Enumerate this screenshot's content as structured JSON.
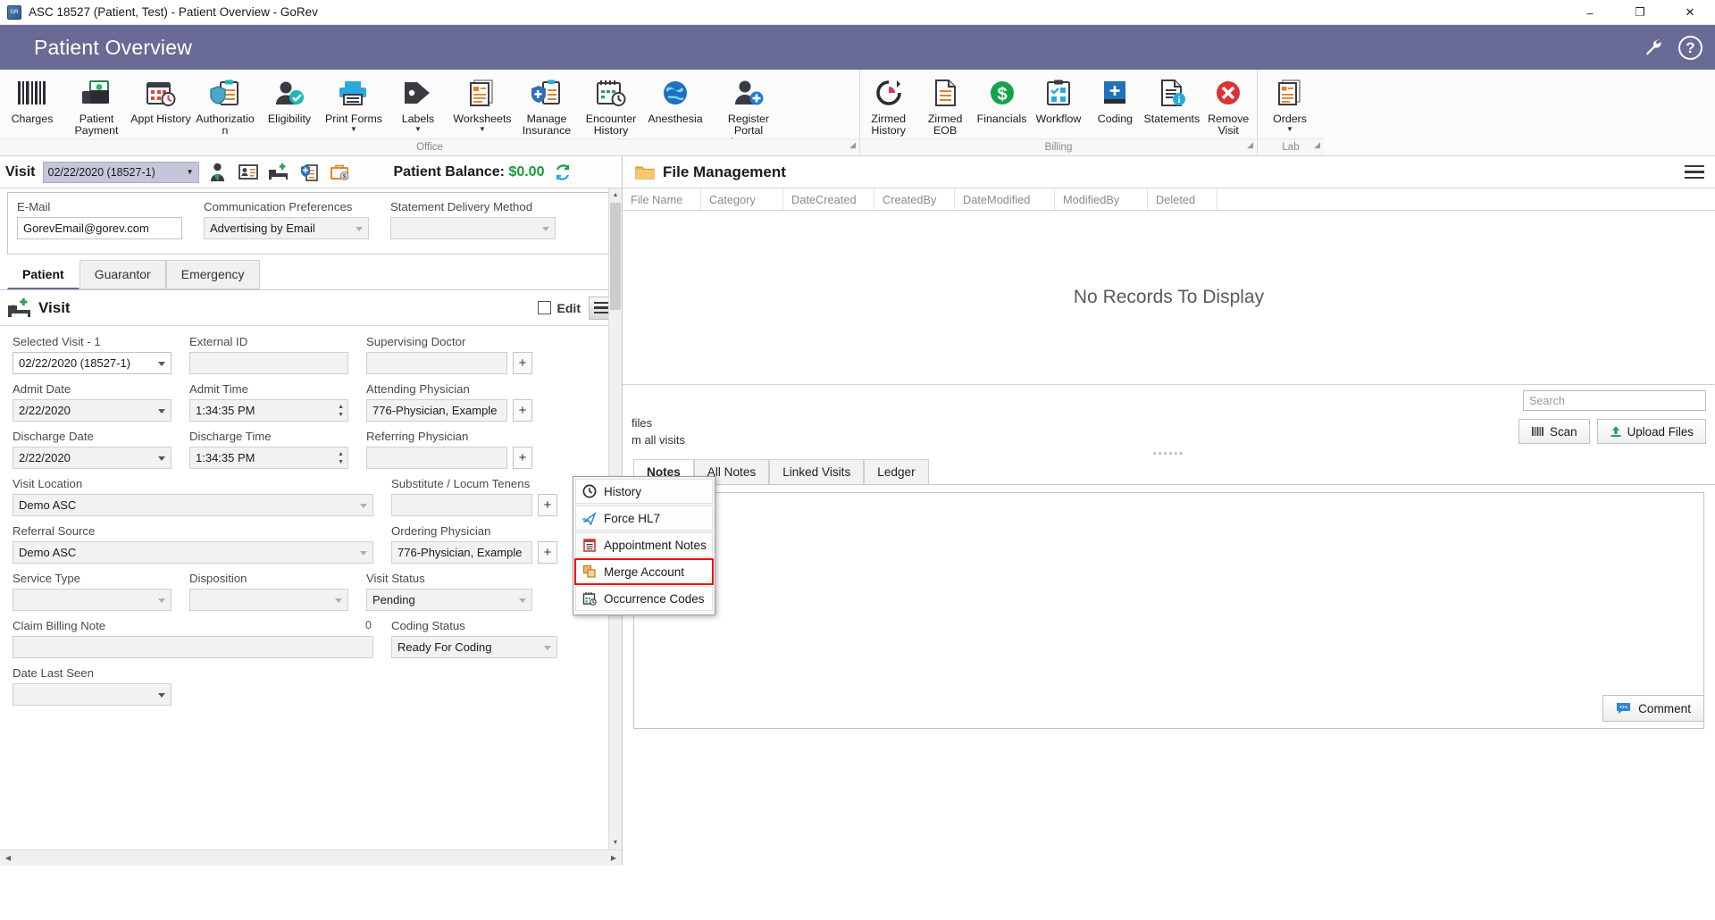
{
  "window": {
    "title": "ASC 18527 (Patient, Test) - Patient Overview - GoRev",
    "minimize": "–",
    "maximize": "❐",
    "close": "✕"
  },
  "header": {
    "title": "Patient Overview",
    "help_label": "?"
  },
  "ribbon": {
    "groups": [
      {
        "name": "Office",
        "label": "Office",
        "items": [
          {
            "label": "Charges",
            "icon": "barcode-icon",
            "caret": false
          },
          {
            "label": "Patient Payment",
            "icon": "money-icon",
            "caret": false
          },
          {
            "label": "Appt History",
            "icon": "calendar-clock-icon",
            "caret": false
          },
          {
            "label": "Authorization",
            "icon": "shield-clipboard-icon",
            "caret": false
          },
          {
            "label": "Eligibility",
            "icon": "person-check-icon",
            "caret": false
          },
          {
            "label": "Print Forms",
            "icon": "printer-icon",
            "caret": false
          },
          {
            "label": "Labels",
            "icon": "tag-icon",
            "caret": true
          },
          {
            "label": "Worksheets",
            "icon": "worksheet-icon",
            "caret": true
          },
          {
            "label": "Manage Insurance",
            "icon": "insurance-icon",
            "caret": false
          },
          {
            "label": "Encounter History",
            "icon": "calendar-history-icon",
            "caret": false
          },
          {
            "label": "Anesthesia",
            "icon": "anesthesia-icon",
            "caret": false
          },
          {
            "label": "Register Portal Account",
            "icon": "person-add-icon",
            "caret": false
          }
        ]
      },
      {
        "name": "Billing",
        "label": "Billing",
        "items": [
          {
            "label": "Zirmed History",
            "icon": "refresh-clock-icon",
            "caret": false
          },
          {
            "label": "Zirmed EOB",
            "icon": "document-list-icon",
            "caret": false
          },
          {
            "label": "Financials",
            "icon": "dollar-circle-icon",
            "caret": false
          },
          {
            "label": "Workflow",
            "icon": "clipboard-check-icon",
            "caret": false
          },
          {
            "label": "Coding",
            "icon": "book-plus-icon",
            "caret": false
          },
          {
            "label": "Statements",
            "icon": "document-info-icon",
            "caret": false
          },
          {
            "label": "Remove Visit",
            "icon": "red-x-icon",
            "caret": true
          }
        ]
      },
      {
        "name": "Lab",
        "label": "Lab",
        "items": [
          {
            "label": "Orders",
            "icon": "orders-icon",
            "caret": true
          }
        ]
      }
    ]
  },
  "visit_bar": {
    "label": "Visit",
    "selected_visit": "02/22/2020 (18527-1)",
    "icons": [
      "patient-icon",
      "id-card-icon",
      "bed-icon",
      "insurance-clipboard-icon",
      "briefcase-dollar-icon"
    ],
    "balance_label": "Patient Balance:",
    "balance_amount": "$0.00",
    "refresh_icon": "refresh-icon"
  },
  "contact": {
    "email_label": "E-Mail",
    "email_value": "GorevEmail@gorev.com",
    "comm_label": "Communication Preferences",
    "comm_value": "Advertising by Email",
    "stmt_label": "Statement Delivery Method",
    "stmt_value": ""
  },
  "tabs": [
    {
      "label": "Patient",
      "active": true
    },
    {
      "label": "Guarantor",
      "active": false
    },
    {
      "label": "Emergency",
      "active": false
    }
  ],
  "visit_section": {
    "icon": "bed-icon",
    "title": "Visit",
    "edit_label": "Edit",
    "menu_icon": "hamburger-icon",
    "fields": {
      "selected_visit_label": "Selected Visit - 1",
      "selected_visit_value": "02/22/2020 (18527-1)",
      "external_id_label": "External ID",
      "external_id_value": "",
      "supervising_doctor_label": "Supervising Doctor",
      "supervising_doctor_value": "",
      "admit_date_label": "Admit Date",
      "admit_date_value": "2/22/2020",
      "admit_time_label": "Admit Time",
      "admit_time_value": "1:34:35 PM",
      "attending_physician_label": "Attending Physician",
      "attending_physician_value": "776-Physician, Example",
      "discharge_date_label": "Discharge Date",
      "discharge_date_value": "2/22/2020",
      "discharge_time_label": "Discharge Time",
      "discharge_time_value": "1:34:35 PM",
      "referring_physician_label": "Referring Physician",
      "referring_physician_value": "",
      "visit_location_label": "Visit Location",
      "visit_location_value": "Demo ASC",
      "substitute_label": "Substitute / Locum Tenens",
      "substitute_value": "",
      "referral_source_label": "Referral Source",
      "referral_source_value": "Demo ASC",
      "ordering_physician_label": "Ordering Physician",
      "ordering_physician_value": "776-Physician, Example",
      "service_type_label": "Service Type",
      "service_type_value": "",
      "disposition_label": "Disposition",
      "disposition_value": "",
      "visit_status_label": "Visit Status",
      "visit_status_value": "Pending",
      "claim_billing_note_label": "Claim Billing Note",
      "claim_billing_note_value": "",
      "claim_billing_note_count": "0",
      "coding_status_label": "Coding Status",
      "coding_status_value": "Ready For Coding",
      "date_last_seen_label": "Date Last Seen",
      "date_last_seen_value": "",
      "plus_label": "+"
    }
  },
  "context_menu": {
    "items": [
      {
        "label": "History",
        "icon": "clock-icon",
        "highlighted": false
      },
      {
        "label": "Force HL7",
        "icon": "send-icon",
        "highlighted": false
      },
      {
        "label": "Appointment Notes",
        "icon": "notes-icon",
        "highlighted": false
      },
      {
        "label": "Merge Account",
        "icon": "merge-icon",
        "highlighted": true
      },
      {
        "label": "Occurrence Codes",
        "icon": "calendar-code-icon",
        "highlighted": false
      }
    ],
    "highlight_color": "#ee1111"
  },
  "file_management": {
    "icon": "folder-icon",
    "title": "File Management",
    "menu_icon": "hamburger-icon",
    "columns": [
      "File Name",
      "Category",
      "DateCreated",
      "CreatedBy",
      "DateModified",
      "ModifiedBy",
      "Deleted"
    ],
    "empty_message": "No Records To Display",
    "search_placeholder": "Search",
    "files_line1": "files",
    "files_line2": "m all visits",
    "scan_label": "Scan",
    "scan_icon": "scanner-icon",
    "upload_label": "Upload Files",
    "upload_icon": "upload-icon"
  },
  "notes_panel": {
    "tabs": [
      {
        "label": "Notes",
        "active": true
      },
      {
        "label": "All Notes",
        "active": false
      },
      {
        "label": "Linked Visits",
        "active": false
      },
      {
        "label": "Ledger",
        "active": false
      }
    ],
    "comment_label": "Comment",
    "comment_icon": "comment-icon",
    "body": ""
  },
  "colors": {
    "header_purple": "#6a6a96",
    "balance_green": "#1a9a3c",
    "highlight_red": "#ee1111",
    "accent_blue": "#1a7fd4"
  }
}
